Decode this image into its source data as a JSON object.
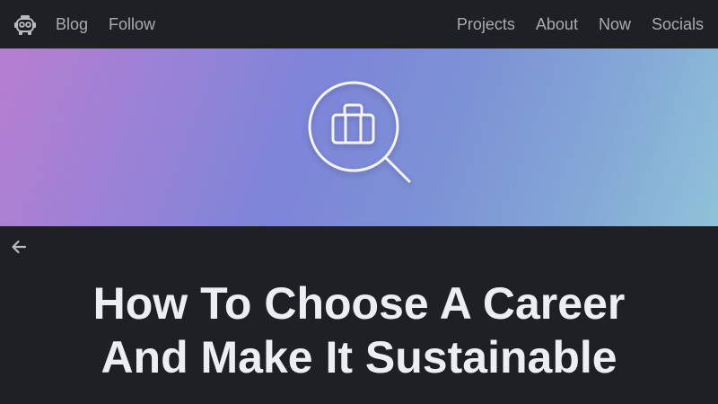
{
  "nav": {
    "left": [
      {
        "label": "Blog"
      },
      {
        "label": "Follow"
      }
    ],
    "right": [
      {
        "label": "Projects"
      },
      {
        "label": "About"
      },
      {
        "label": "Now"
      },
      {
        "label": "Socials"
      }
    ]
  },
  "icons": {
    "logo": "robot-logo-icon",
    "hero": "magnifier-briefcase-icon",
    "back": "arrow-left-icon"
  },
  "colors": {
    "background": "#1f2023",
    "nav_text": "#a9abb1",
    "title_text": "#eceef2",
    "hero_gradient": [
      "#b67ed1",
      "#7d85d8",
      "#8fc2d8"
    ]
  },
  "article": {
    "title_line1": "How To Choose A Career",
    "title_line2": "And Make It Sustainable"
  }
}
